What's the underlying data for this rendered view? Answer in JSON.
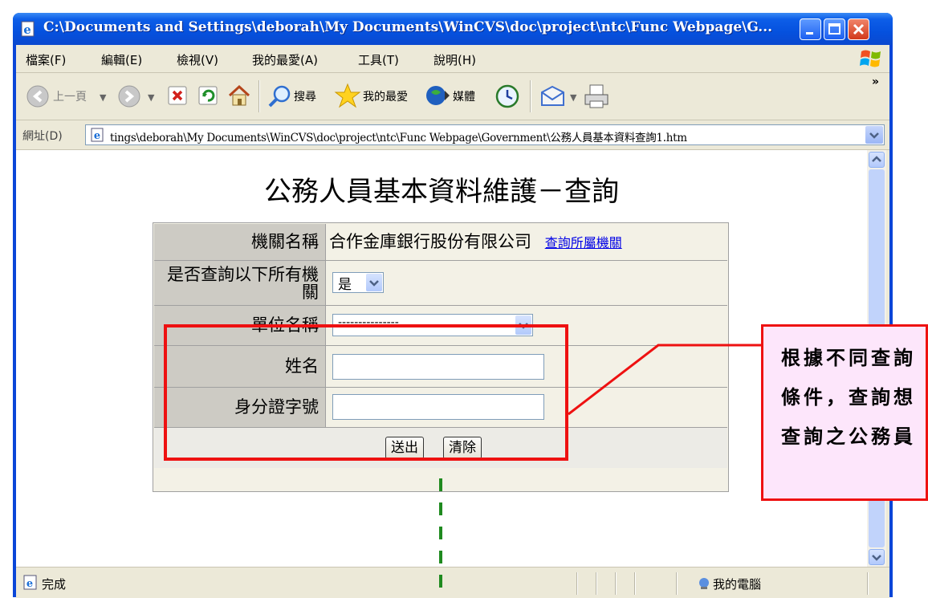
{
  "window": {
    "title": "C:\\Documents and Settings\\deborah\\My Documents\\WinCVS\\doc\\project\\ntc\\Func Webpage\\G..."
  },
  "menu": {
    "items": [
      "檔案(F)",
      "編輯(E)",
      "檢視(V)",
      "我的最愛(A)",
      "工具(T)",
      "說明(H)"
    ]
  },
  "toolbar": {
    "back_label": "上一頁",
    "search_label": "搜尋",
    "favorites_label": "我的最愛",
    "media_label": "媒體",
    "more": "»"
  },
  "address": {
    "label": "網址(D)",
    "url": "tings\\deborah\\My Documents\\WinCVS\\doc\\project\\ntc\\Func Webpage\\Government\\公務人員基本資料查詢1.htm"
  },
  "page": {
    "title": "公務人員基本資料維護－查詢"
  },
  "form": {
    "agency_label": "機關名稱",
    "agency_value": "合作金庫銀行股份有限公司",
    "agency_link": "查詢所屬機關",
    "include_sub_label": "是否查詢以下所有機關",
    "include_sub_value": "是",
    "unit_label": "單位名稱",
    "unit_value": "---------------",
    "name_label": "姓名",
    "name_value": "",
    "id_label": "身分證字號",
    "id_value": "",
    "submit_label": "送出",
    "clear_label": "清除"
  },
  "status": {
    "text": "完成",
    "zone": "我的電腦"
  },
  "annotation": {
    "callout": "根據不同查詢條件，查詢想查詢之公務員",
    "accent_color": "#ee1111",
    "callout_bg": "#fde6fb",
    "dashed_color": "#1f8a1f"
  }
}
